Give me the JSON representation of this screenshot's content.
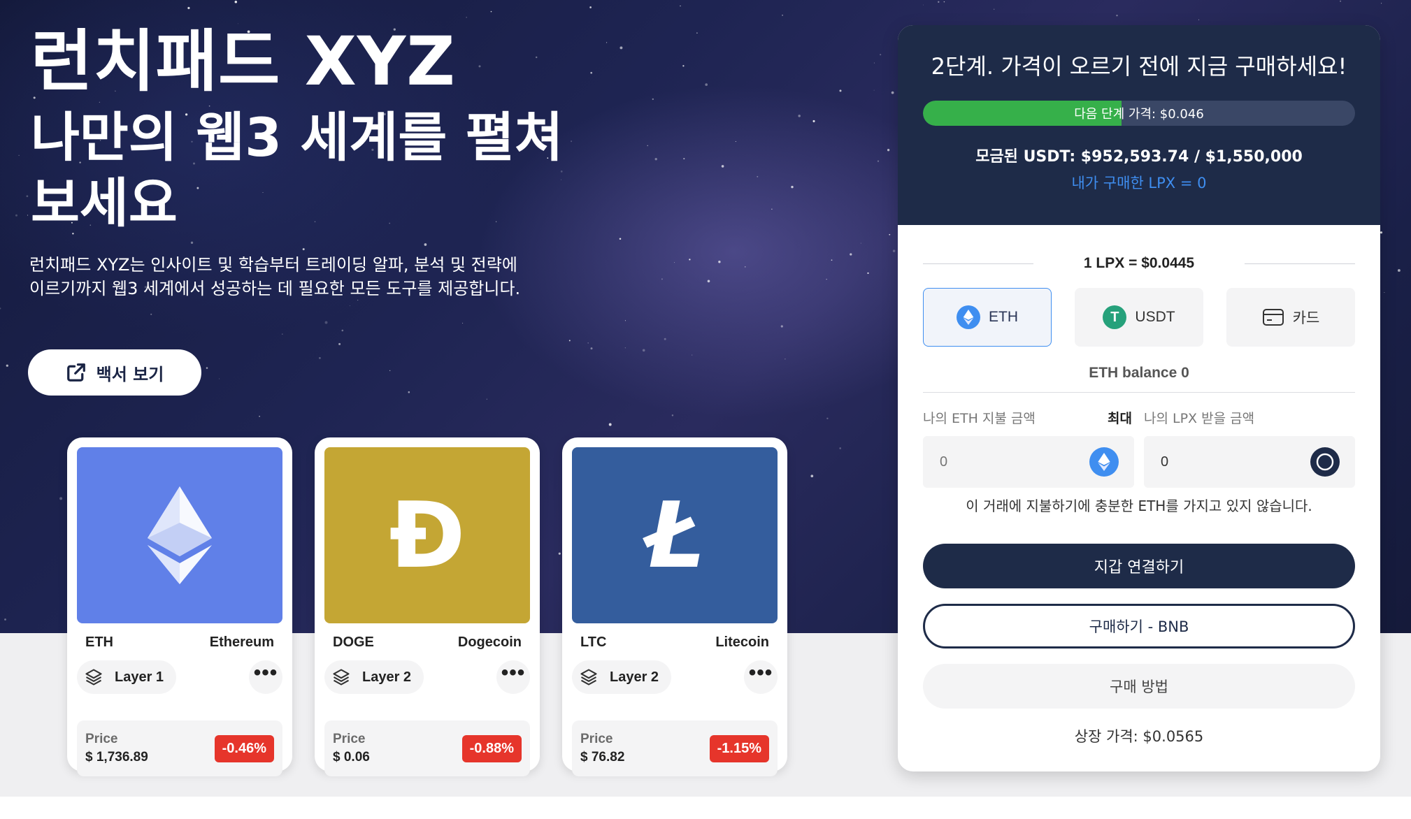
{
  "hero": {
    "title_line1": "런치패드 XYZ",
    "title_line2": "나만의 웹3 세계를 펼쳐보세요",
    "description": "런치패드 XYZ는 인사이트 및 학습부터 트레이딩 알파, 분석 및 전략에 이르기까지 웹3 세계에서 성공하는 데 필요한 모든 도구를 제공합니다.",
    "whitepaper_button": "백서 보기",
    "whitepaper_icon": "external-link-icon"
  },
  "coins": [
    {
      "symbol": "ETH",
      "name": "Ethereum",
      "layer": "Layer 1",
      "price_label": "Price",
      "price": "$ 1,736.89",
      "change": "-0.46%",
      "art_color": "#6080e8",
      "glyph": "ethereum-diamond-icon"
    },
    {
      "symbol": "DOGE",
      "name": "Dogecoin",
      "layer": "Layer 2",
      "price_label": "Price",
      "price": "$ 0.06",
      "change": "-0.88%",
      "art_color": "#c4a634",
      "glyph": "Ð"
    },
    {
      "symbol": "LTC",
      "name": "Litecoin",
      "layer": "Layer 2",
      "price_label": "Price",
      "price": "$ 76.82",
      "change": "-1.15%",
      "art_color": "#345d9d",
      "glyph": "Ł"
    }
  ],
  "more_icon": "•••",
  "panel": {
    "title": "2단계. 가격이 오르기 전에 지금 구매하세요!",
    "progress_label": "다음 단계 가격: $0.046",
    "progress_fraction": 0.46,
    "raised": "모금된 USDT: $952,593.74 / $1,550,000",
    "my_purchase": "내가 구매한 LPX = 0",
    "rate": "1 LPX = $0.0445",
    "tabs": [
      {
        "label": "ETH",
        "icon": "ethereum-icon",
        "active": true
      },
      {
        "label": "USDT",
        "icon": "tether-icon",
        "active": false
      },
      {
        "label": "카드",
        "icon": "credit-card-icon",
        "active": false
      }
    ],
    "balance": "ETH balance 0",
    "pay_label": "나의 ETH 지불 금액",
    "max_label": "최대",
    "receive_label": "나의 LPX 받을 금액",
    "pay_placeholder": "0",
    "receive_value": "0",
    "warning": "이 거래에 지불하기에 충분한 ETH를 가지고 있지 않습니다.",
    "connect_button": "지갑 연결하기",
    "buy_bnb_button": "구매하기 - BNB",
    "how_to_button": "구매 방법",
    "listing_price": "상장 가격: $0.0565",
    "colors": {
      "navy": "#1e2b48",
      "green": "#36b04a",
      "blue": "#3f8ef0",
      "red": "#e6352b"
    }
  }
}
